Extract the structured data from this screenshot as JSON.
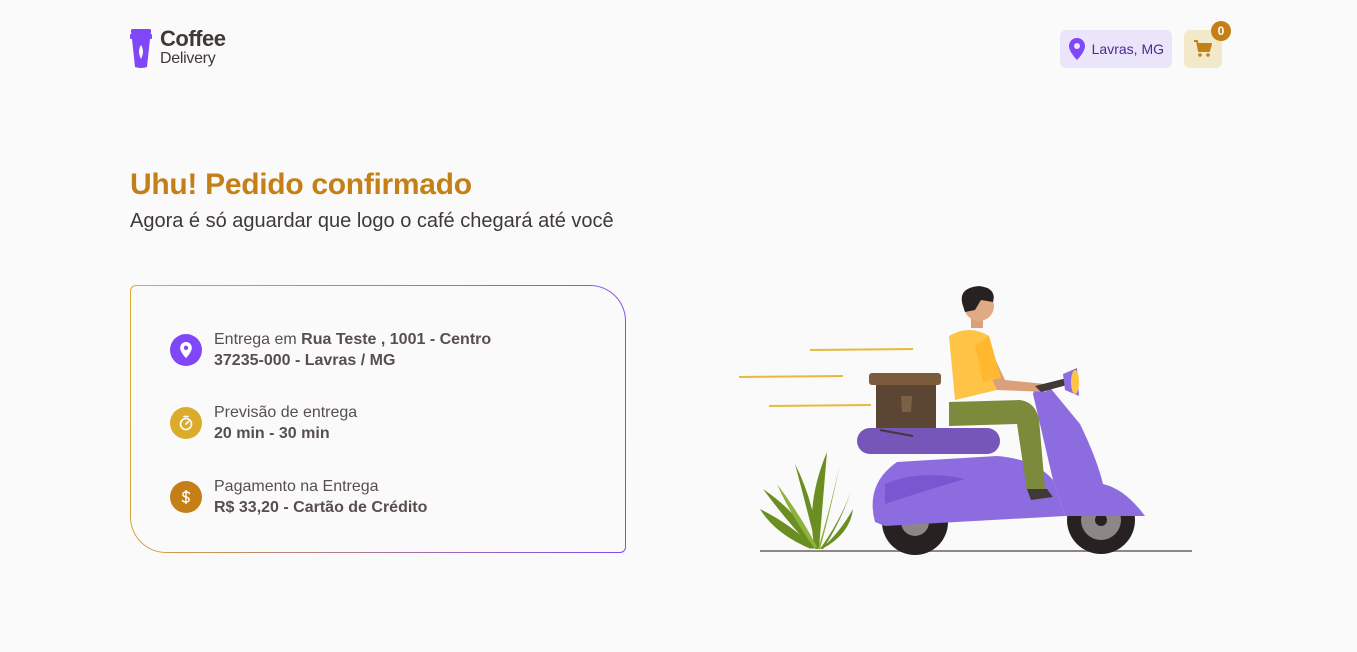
{
  "header": {
    "logo_line1": "Coffee",
    "logo_line2": "Delivery",
    "location": "Lavras, MG",
    "cart_count": "0",
    "icons": {
      "logo": "coffee-cup-icon",
      "location": "map-pin-icon",
      "cart": "shopping-cart-icon"
    }
  },
  "page": {
    "title": "Uhu! Pedido confirmado",
    "subtitle": "Agora é só aguardar que logo o café chegará até você"
  },
  "order_info": {
    "delivery": {
      "prefix": "Entrega em ",
      "street": "Rua Teste , 1001 - Centro",
      "city": "37235-000 - Lavras / MG",
      "icon": "map-pin-icon",
      "icon_color": "#8047F8"
    },
    "eta": {
      "label": "Previsão de entrega",
      "value": "20 min - 30 min",
      "icon": "timer-icon",
      "icon_color": "#DBAC2C"
    },
    "payment": {
      "label": "Pagamento na Entrega",
      "value": "R$ 33,20 - Cartão de Crédito",
      "icon": "currency-dollar-icon",
      "icon_color": "#C47F17"
    }
  },
  "colors": {
    "accent_yellow_dark": "#C47F17",
    "accent_yellow": "#DBAC2C",
    "accent_purple": "#8047F8",
    "accent_purple_dark": "#4B2995",
    "text": "#403937"
  }
}
